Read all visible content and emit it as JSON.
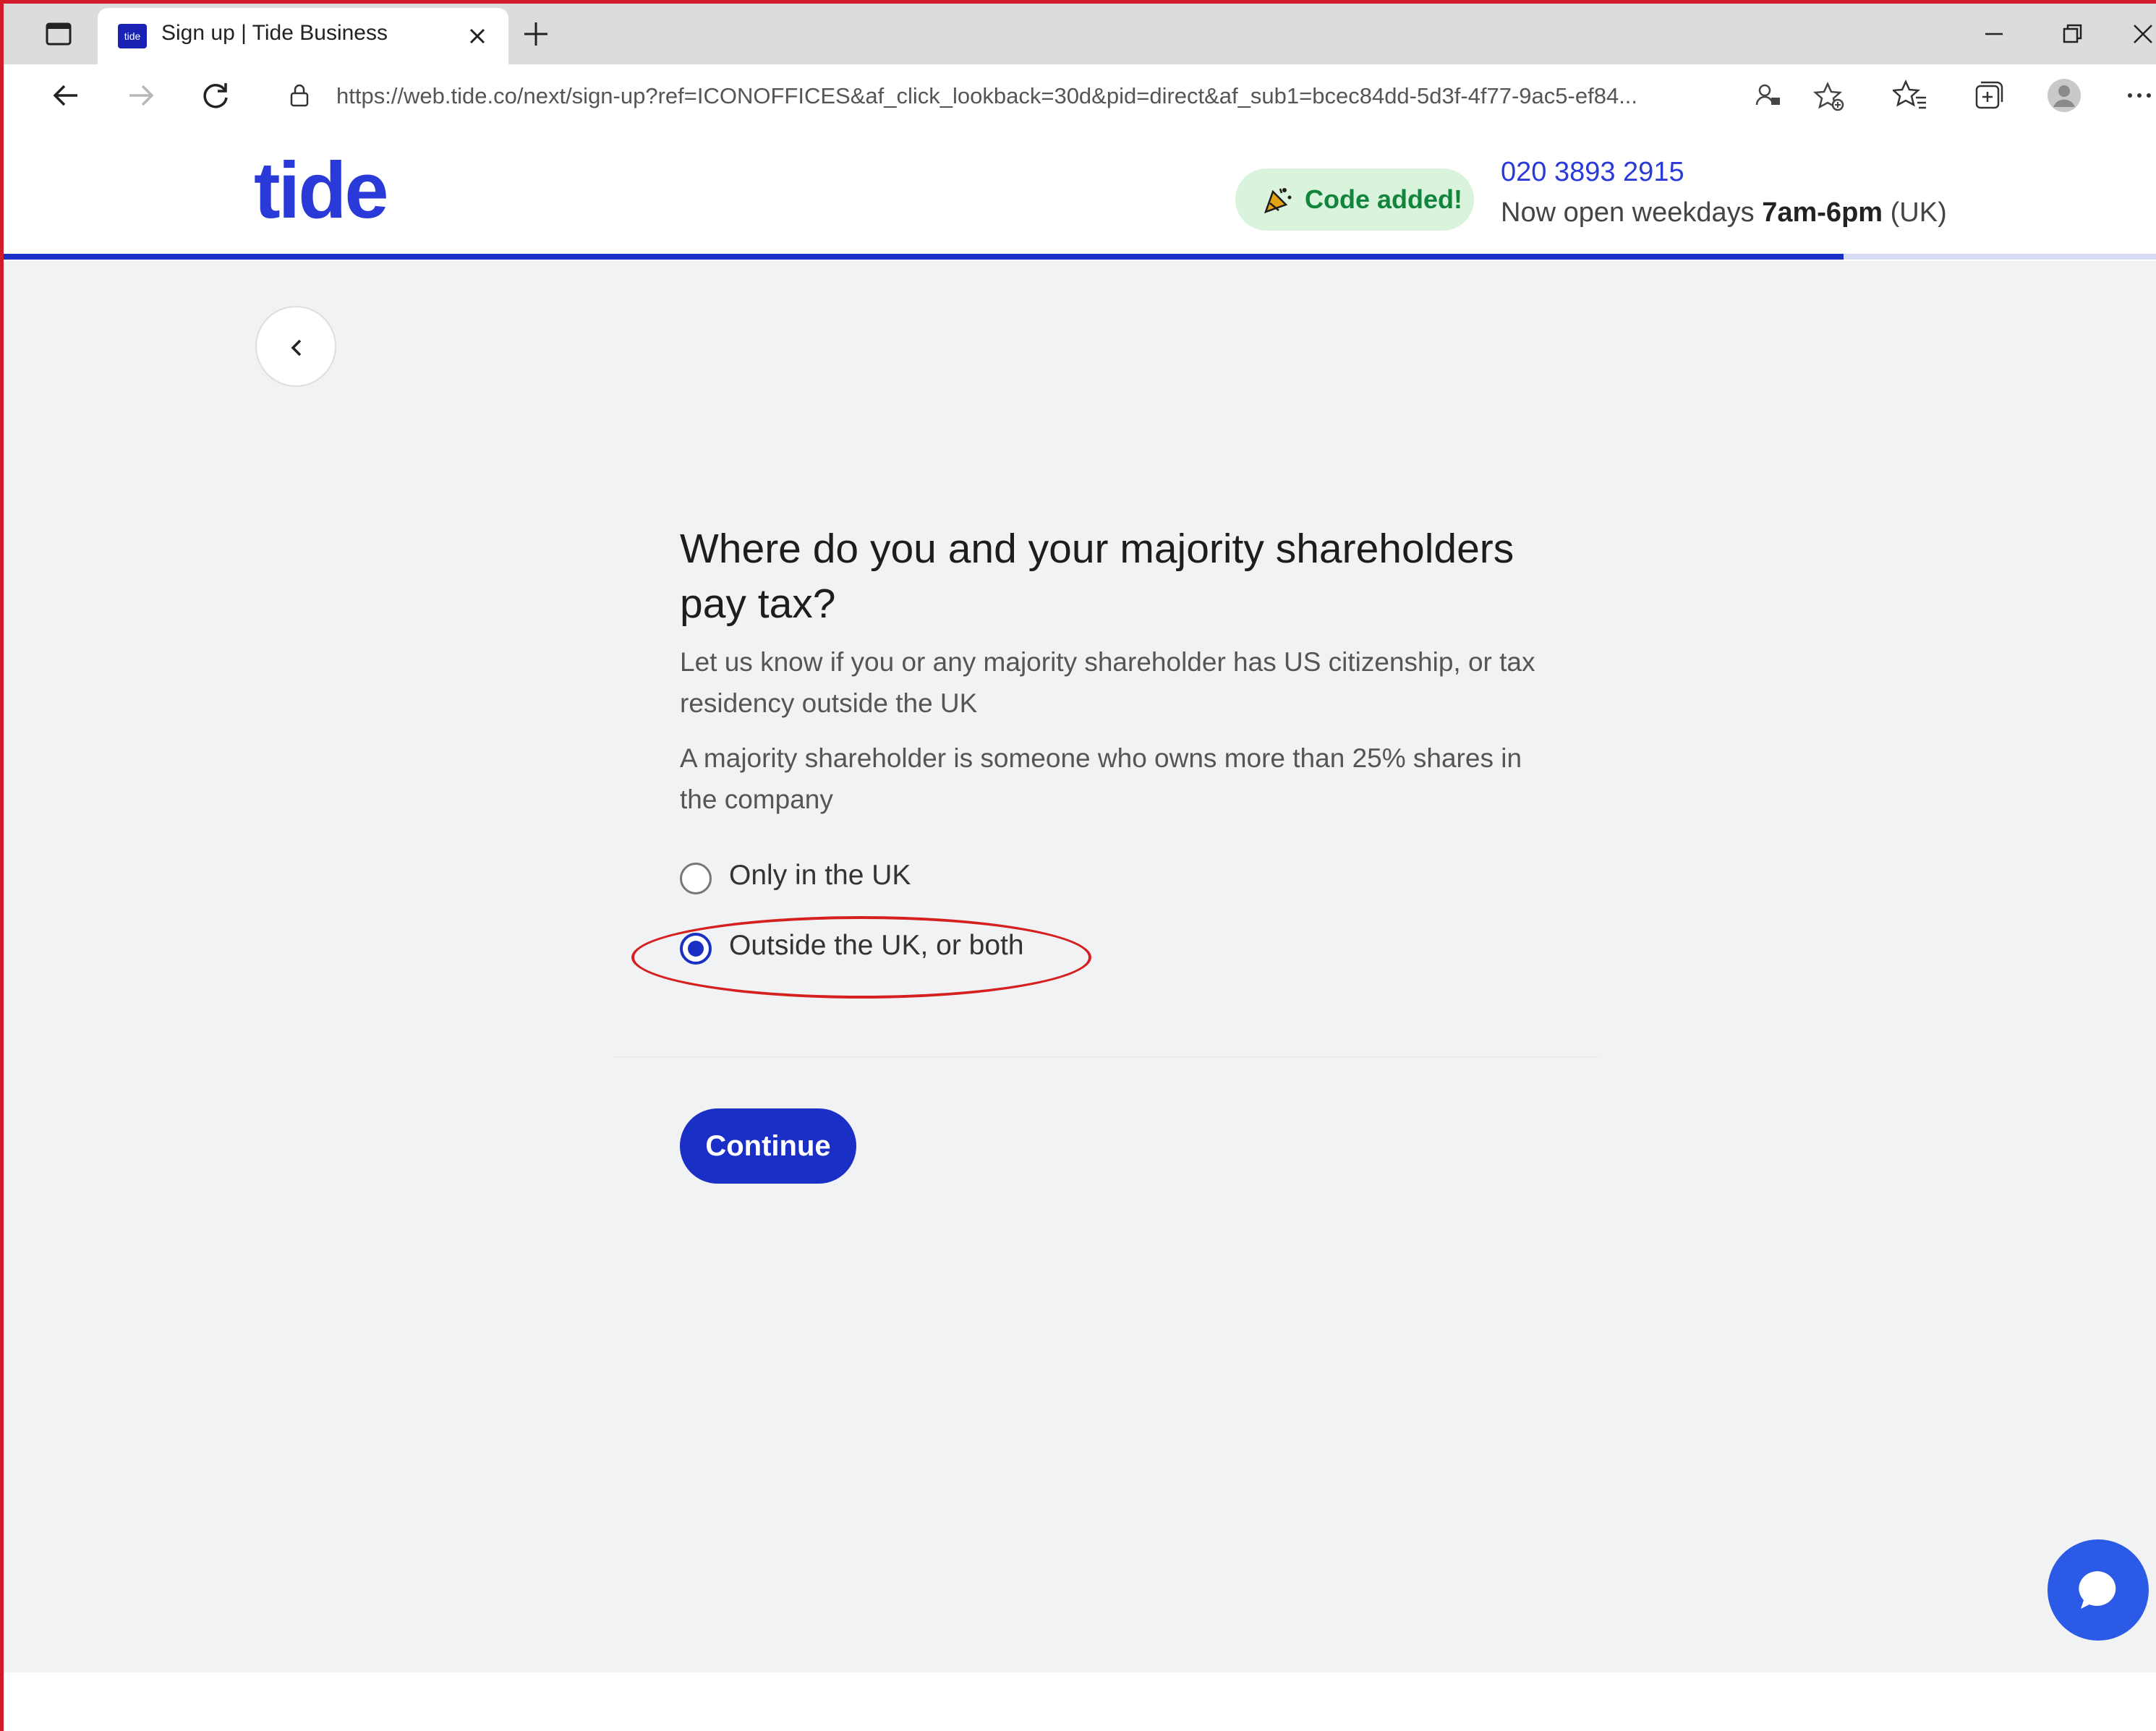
{
  "browser": {
    "tab_title": "Sign up | Tide Business",
    "tab_favicon_text": "tide",
    "url": "https://web.tide.co/next/sign-up?ref=ICONOFFICES&af_click_lookback=30d&pid=direct&af_sub1=bcec84dd-5d3f-4f77-9ac5-ef84..."
  },
  "header": {
    "logo": "tide",
    "code_badge": "Code added!",
    "phone": "020 3893 2915",
    "hours_prefix": "Now open weekdays",
    "hours_time": "7am-6pm",
    "hours_suffix": "(UK)",
    "progress_fraction": 0.855
  },
  "form": {
    "question": "Where do you and your majority shareholders pay tax?",
    "description_1": "Let us know if you or any majority shareholder has US citizenship, or tax residency outside the UK",
    "description_2": "A majority shareholder is someone who owns more than 25% shares in the company",
    "options": [
      {
        "label": "Only in the UK",
        "checked": false
      },
      {
        "label": "Outside the UK, or both",
        "checked": true
      }
    ],
    "continue_label": "Continue"
  },
  "colors": {
    "brand": "#2a3ad8",
    "button": "#1a2fc5",
    "badge_bg": "#d9f3dd",
    "badge_text": "#13843b",
    "annotation": "#d62020"
  },
  "icons": {
    "tab_actions": "tab-actions-icon",
    "close": "close-icon",
    "new_tab": "plus-icon",
    "back": "arrow-left-icon",
    "forward": "arrow-right-icon",
    "refresh": "refresh-icon",
    "lock": "lock-icon",
    "chat": "chat-icon"
  }
}
